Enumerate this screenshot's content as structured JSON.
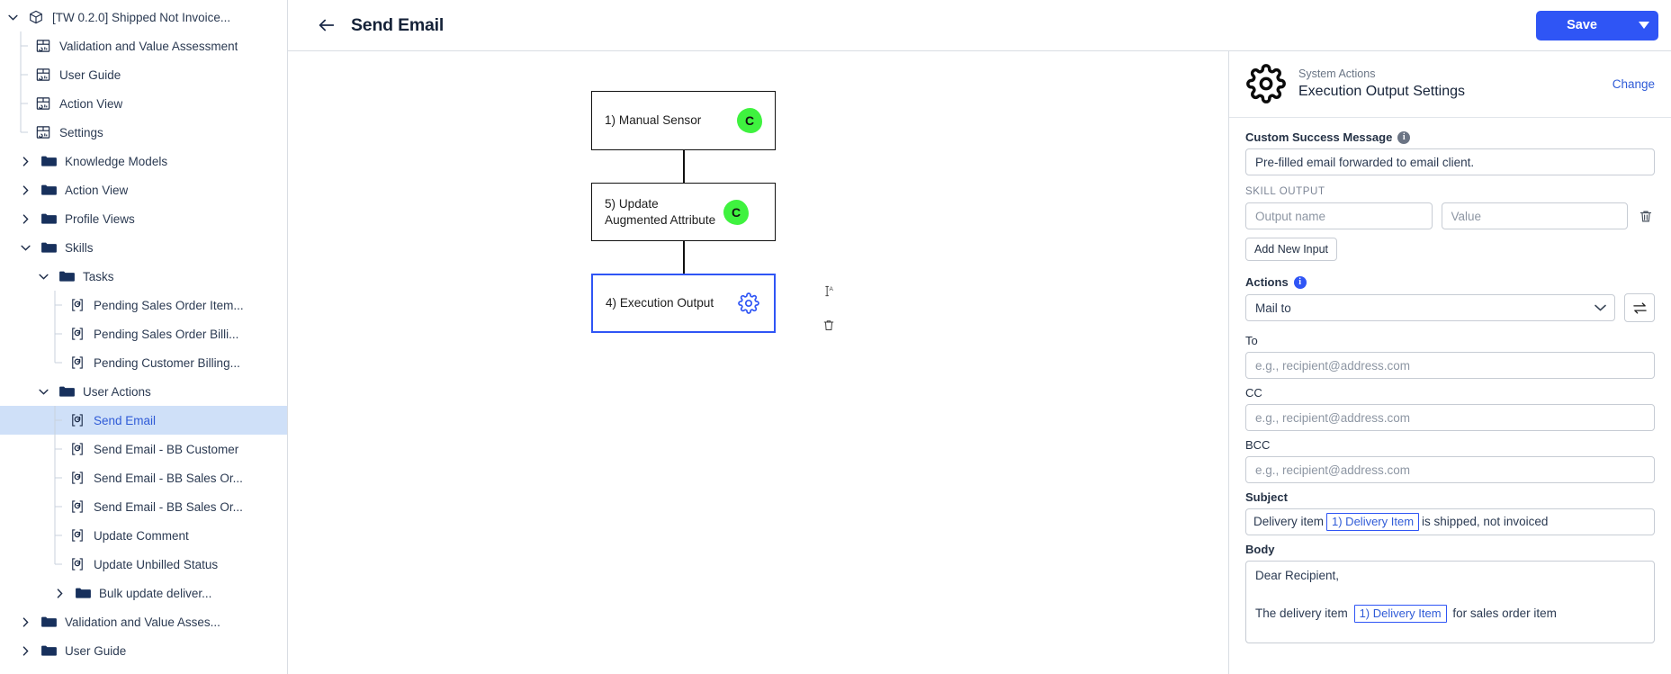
{
  "sidebar": {
    "items": [
      {
        "label": "[TW 0.2.0] Shipped Not Invoice...",
        "icon": "cube-icon",
        "type": "root",
        "depth": 0,
        "expanded": true,
        "chev": "down"
      },
      {
        "label": "Validation and Value Assessment",
        "icon": "table-view-icon",
        "type": "leaf",
        "depth": 1,
        "chev": "none"
      },
      {
        "label": "User Guide",
        "icon": "table-view-icon",
        "type": "leaf",
        "depth": 1,
        "chev": "none"
      },
      {
        "label": "Action View",
        "icon": "table-view-icon",
        "type": "leaf",
        "depth": 1,
        "chev": "none"
      },
      {
        "label": "Settings",
        "icon": "table-view-icon",
        "type": "leaf",
        "depth": 1,
        "chev": "none",
        "last": true
      },
      {
        "label": "Knowledge Models",
        "icon": "folder-icon",
        "type": "folder",
        "depth": 1,
        "chev": "right"
      },
      {
        "label": "Action View",
        "icon": "folder-icon",
        "type": "folder",
        "depth": 1,
        "chev": "right"
      },
      {
        "label": "Profile Views",
        "icon": "folder-icon",
        "type": "folder",
        "depth": 1,
        "chev": "right"
      },
      {
        "label": "Skills",
        "icon": "folder-icon",
        "type": "folder",
        "depth": 1,
        "chev": "down",
        "expanded": true
      },
      {
        "label": "Tasks",
        "icon": "folder-icon",
        "type": "folder",
        "depth": 2,
        "chev": "down",
        "expanded": true
      },
      {
        "label": "Pending Sales Order Item...",
        "icon": "skill-icon",
        "type": "leaf",
        "depth": 3,
        "chev": "none"
      },
      {
        "label": "Pending Sales Order Billi...",
        "icon": "skill-icon",
        "type": "leaf",
        "depth": 3,
        "chev": "none"
      },
      {
        "label": "Pending Customer Billing...",
        "icon": "skill-icon",
        "type": "leaf",
        "depth": 3,
        "chev": "none",
        "last": true
      },
      {
        "label": "User Actions",
        "icon": "folder-icon",
        "type": "folder",
        "depth": 2,
        "chev": "down",
        "expanded": true
      },
      {
        "label": "Send Email",
        "icon": "skill-icon",
        "type": "leaf",
        "depth": 3,
        "chev": "none",
        "selected": true
      },
      {
        "label": "Send Email - BB Customer",
        "icon": "skill-icon",
        "type": "leaf",
        "depth": 3,
        "chev": "none"
      },
      {
        "label": "Send Email - BB Sales Or...",
        "icon": "skill-icon",
        "type": "leaf",
        "depth": 3,
        "chev": "none"
      },
      {
        "label": "Send Email - BB Sales Or...",
        "icon": "skill-icon",
        "type": "leaf",
        "depth": 3,
        "chev": "none"
      },
      {
        "label": "Update Comment",
        "icon": "skill-icon",
        "type": "leaf",
        "depth": 3,
        "chev": "none"
      },
      {
        "label": "Update Unbilled Status",
        "icon": "skill-icon",
        "type": "leaf",
        "depth": 3,
        "chev": "none",
        "last": true
      },
      {
        "label": "Bulk update deliver...",
        "icon": "folder-icon",
        "type": "folder",
        "depth": 3,
        "chev": "right"
      },
      {
        "label": "Validation and Value Asses...",
        "icon": "folder-icon",
        "type": "folder",
        "depth": 1,
        "chev": "right"
      },
      {
        "label": "User Guide",
        "icon": "folder-icon",
        "type": "folder",
        "depth": 1,
        "chev": "right"
      }
    ]
  },
  "topbar": {
    "back_icon": "arrow-left-icon",
    "title": "Send Email",
    "save_label": "Save",
    "save_caret_icon": "chevron-down-icon"
  },
  "flow": {
    "nodes": [
      {
        "label": "1) Manual Sensor",
        "badge": "C",
        "badge_type": "green-blob",
        "selected": false
      },
      {
        "label": "5) Update Augmented Attribute",
        "badge": "C",
        "badge_type": "green-blob",
        "selected": false
      },
      {
        "label": "4) Execution Output",
        "badge": "",
        "badge_type": "gear",
        "selected": true
      }
    ],
    "side_tools": [
      {
        "icon": "rename-text-icon"
      },
      {
        "icon": "delete-trash-icon"
      }
    ]
  },
  "panel": {
    "header": {
      "icon": "gear-icon",
      "category": "System Actions",
      "title": "Execution Output Settings",
      "change_label": "Change"
    },
    "custom_success_message": {
      "label": "Custom Success Message",
      "info_icon": "info-icon",
      "value": "Pre-filled email forwarded to email client."
    },
    "skill_output": {
      "caption": "SKILL OUTPUT",
      "name_placeholder": "Output name",
      "name_value": "",
      "value_placeholder": "Value",
      "value_value": "",
      "delete_icon": "trash-icon",
      "add_button_label": "Add New Input"
    },
    "actions": {
      "label": "Actions",
      "info_icon": "info-icon",
      "selected": "Mail to",
      "options": [
        "Mail to"
      ],
      "caret_icon": "chevron-down-icon",
      "swap_icon": "swap-arrows-icon"
    },
    "to": {
      "label": "To",
      "placeholder": "e.g., recipient@address.com",
      "value": ""
    },
    "cc": {
      "label": "CC",
      "placeholder": "e.g., recipient@address.com",
      "value": ""
    },
    "bcc": {
      "label": "BCC",
      "placeholder": "e.g., recipient@address.com",
      "value": ""
    },
    "subject": {
      "label": "Subject",
      "prefix": "Delivery item",
      "token": "1) Delivery Item",
      "suffix": "is shipped, not invoiced"
    },
    "body": {
      "label": "Body",
      "line1": "Dear Recipient,",
      "line2_prefix": "The delivery item",
      "line2_token": "1) Delivery Item",
      "line2_suffix": "for sales order item"
    }
  },
  "colors": {
    "accent": "#2f55f5",
    "link": "#2f5bd7",
    "selected_row_bg": "#cfe0f8",
    "badge_green": "#3ff23f",
    "text_dark": "#152238",
    "border": "#d9dde3"
  }
}
